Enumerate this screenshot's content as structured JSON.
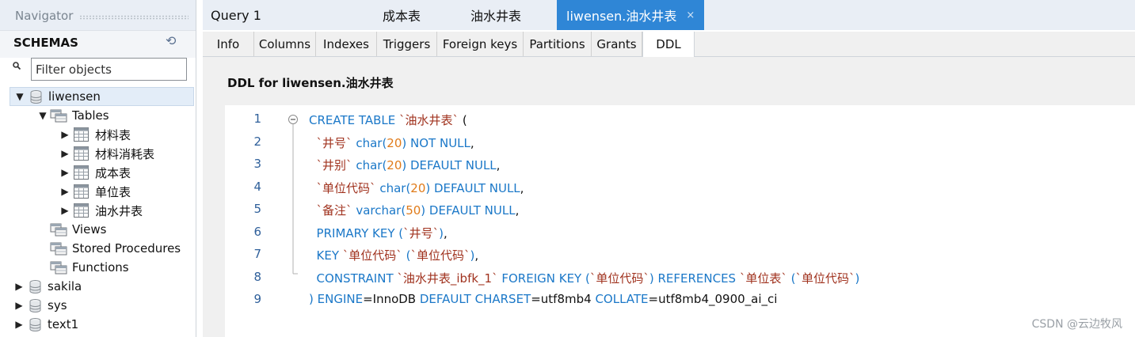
{
  "navigator": {
    "title": "Navigator",
    "schemas_label": "SCHEMAS",
    "filter_placeholder": "Filter objects",
    "tree": [
      {
        "label": "liwensen",
        "level": 0,
        "arrow": "▼",
        "icon": "database-icon",
        "selected": true
      },
      {
        "label": "Tables",
        "level": 1,
        "arrow": "▼",
        "icon": "folder-icon"
      },
      {
        "label": "材料表",
        "level": 2,
        "arrow": "▶",
        "icon": "table-icon"
      },
      {
        "label": "材料消耗表",
        "level": 2,
        "arrow": "▶",
        "icon": "table-icon"
      },
      {
        "label": "成本表",
        "level": 2,
        "arrow": "▶",
        "icon": "table-icon"
      },
      {
        "label": "单位表",
        "level": 2,
        "arrow": "▶",
        "icon": "table-icon"
      },
      {
        "label": "油水井表",
        "level": 2,
        "arrow": "▶",
        "icon": "table-icon"
      },
      {
        "label": "Views",
        "level": 1,
        "arrow": "",
        "icon": "folder-icon"
      },
      {
        "label": "Stored Procedures",
        "level": 1,
        "arrow": "",
        "icon": "folder-icon"
      },
      {
        "label": "Functions",
        "level": 1,
        "arrow": "",
        "icon": "folder-icon"
      },
      {
        "label": "sakila",
        "level": 0,
        "arrow": "▶",
        "icon": "database-icon"
      },
      {
        "label": "sys",
        "level": 0,
        "arrow": "▶",
        "icon": "database-icon"
      },
      {
        "label": "text1",
        "level": 0,
        "arrow": "▶",
        "icon": "database-icon"
      }
    ]
  },
  "query_tabs": [
    {
      "label": "Query 1",
      "active": false
    },
    {
      "label": "成本表",
      "active": false
    },
    {
      "label": "油水井表",
      "active": false
    },
    {
      "label": "liwensen.油水井表",
      "active": true,
      "close": "×"
    }
  ],
  "sub_tabs": [
    "Info",
    "Columns",
    "Indexes",
    "Triggers",
    "Foreign keys",
    "Partitions",
    "Grants",
    "DDL"
  ],
  "active_sub_tab": "DDL",
  "ddl_title": "DDL for liwensen.油水井表",
  "code_lines": [
    {
      "n": "1",
      "tokens": [
        [
          "kw",
          "CREATE TABLE "
        ],
        [
          "str",
          "`油水井表`"
        ],
        [
          "pl",
          " ("
        ]
      ]
    },
    {
      "n": "2",
      "tokens": [
        [
          "pl",
          "  "
        ],
        [
          "str",
          "`井号`"
        ],
        [
          "kw",
          " char("
        ],
        [
          "num",
          "20"
        ],
        [
          "kw",
          ") NOT NULL"
        ],
        [
          "pl",
          ","
        ]
      ]
    },
    {
      "n": "3",
      "tokens": [
        [
          "pl",
          "  "
        ],
        [
          "str",
          "`井别`"
        ],
        [
          "kw",
          " char("
        ],
        [
          "num",
          "20"
        ],
        [
          "kw",
          ") DEFAULT NULL"
        ],
        [
          "pl",
          ","
        ]
      ]
    },
    {
      "n": "4",
      "tokens": [
        [
          "pl",
          "  "
        ],
        [
          "str",
          "`单位代码`"
        ],
        [
          "kw",
          " char("
        ],
        [
          "num",
          "20"
        ],
        [
          "kw",
          ") DEFAULT NULL"
        ],
        [
          "pl",
          ","
        ]
      ]
    },
    {
      "n": "5",
      "tokens": [
        [
          "pl",
          "  "
        ],
        [
          "str",
          "`备注`"
        ],
        [
          "kw",
          " varchar("
        ],
        [
          "num",
          "50"
        ],
        [
          "kw",
          ") DEFAULT NULL"
        ],
        [
          "pl",
          ","
        ]
      ]
    },
    {
      "n": "6",
      "tokens": [
        [
          "pl",
          "  "
        ],
        [
          "kw",
          "PRIMARY KEY ("
        ],
        [
          "str",
          "`井号`"
        ],
        [
          "kw",
          ")"
        ],
        [
          "pl",
          ","
        ]
      ]
    },
    {
      "n": "7",
      "tokens": [
        [
          "pl",
          "  "
        ],
        [
          "kw",
          "KEY "
        ],
        [
          "str",
          "`单位代码`"
        ],
        [
          "kw",
          " ("
        ],
        [
          "str",
          "`单位代码`"
        ],
        [
          "kw",
          ")"
        ],
        [
          "pl",
          ","
        ]
      ]
    },
    {
      "n": "8",
      "tokens": [
        [
          "pl",
          "  "
        ],
        [
          "kw",
          "CONSTRAINT "
        ],
        [
          "str",
          "`油水井表_ibfk_1`"
        ],
        [
          "kw",
          " FOREIGN KEY ("
        ],
        [
          "str",
          "`单位代码`"
        ],
        [
          "kw",
          ") REFERENCES "
        ],
        [
          "str",
          "`单位表`"
        ],
        [
          "kw",
          " ("
        ],
        [
          "str",
          "`单位代码`"
        ],
        [
          "kw",
          ")"
        ]
      ]
    },
    {
      "n": "9",
      "tokens": [
        [
          "kw",
          ") ENGINE"
        ],
        [
          "pl",
          "=InnoDB "
        ],
        [
          "kw",
          "DEFAULT CHARSET"
        ],
        [
          "pl",
          "=utf8mb4 "
        ],
        [
          "kw",
          "COLLATE"
        ],
        [
          "pl",
          "=utf8mb4_0900_ai_ci"
        ]
      ]
    }
  ],
  "watermark": "CSDN @云边牧风",
  "colors": {
    "accent": "#2f86d6",
    "keyword": "#1b78c8",
    "string": "#a0321e",
    "number": "#e07b1a"
  }
}
